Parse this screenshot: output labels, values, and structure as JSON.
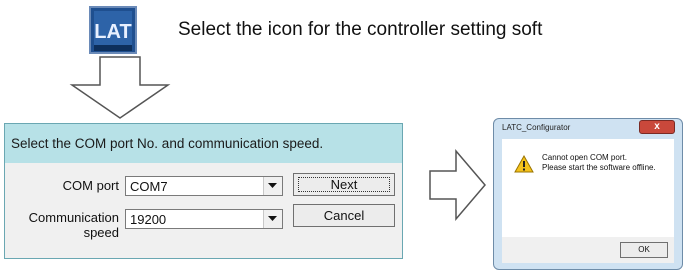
{
  "instruction": "Select the icon for the controller setting soft",
  "app_icon": {
    "name": "latc-configurator-icon",
    "text": "LAT"
  },
  "com_dialog": {
    "title": "Select the COM port No. and communication speed.",
    "com_port_label": "COM port",
    "com_port_value": "COM7",
    "speed_label_line1": "Communication",
    "speed_label_line2": "speed",
    "speed_value": "19200",
    "next_label": "Next",
    "cancel_label": "Cancel"
  },
  "error_dialog": {
    "title": "LATC_Configurator",
    "close_label": "x",
    "message_line1": "Cannot open COM port.",
    "message_line2": "Please start the software offline.",
    "ok_label": "OK"
  },
  "colors": {
    "title_bar": "#b7e1e7",
    "dialog_bg": "#f0f0f0",
    "close": "#c9483b"
  }
}
